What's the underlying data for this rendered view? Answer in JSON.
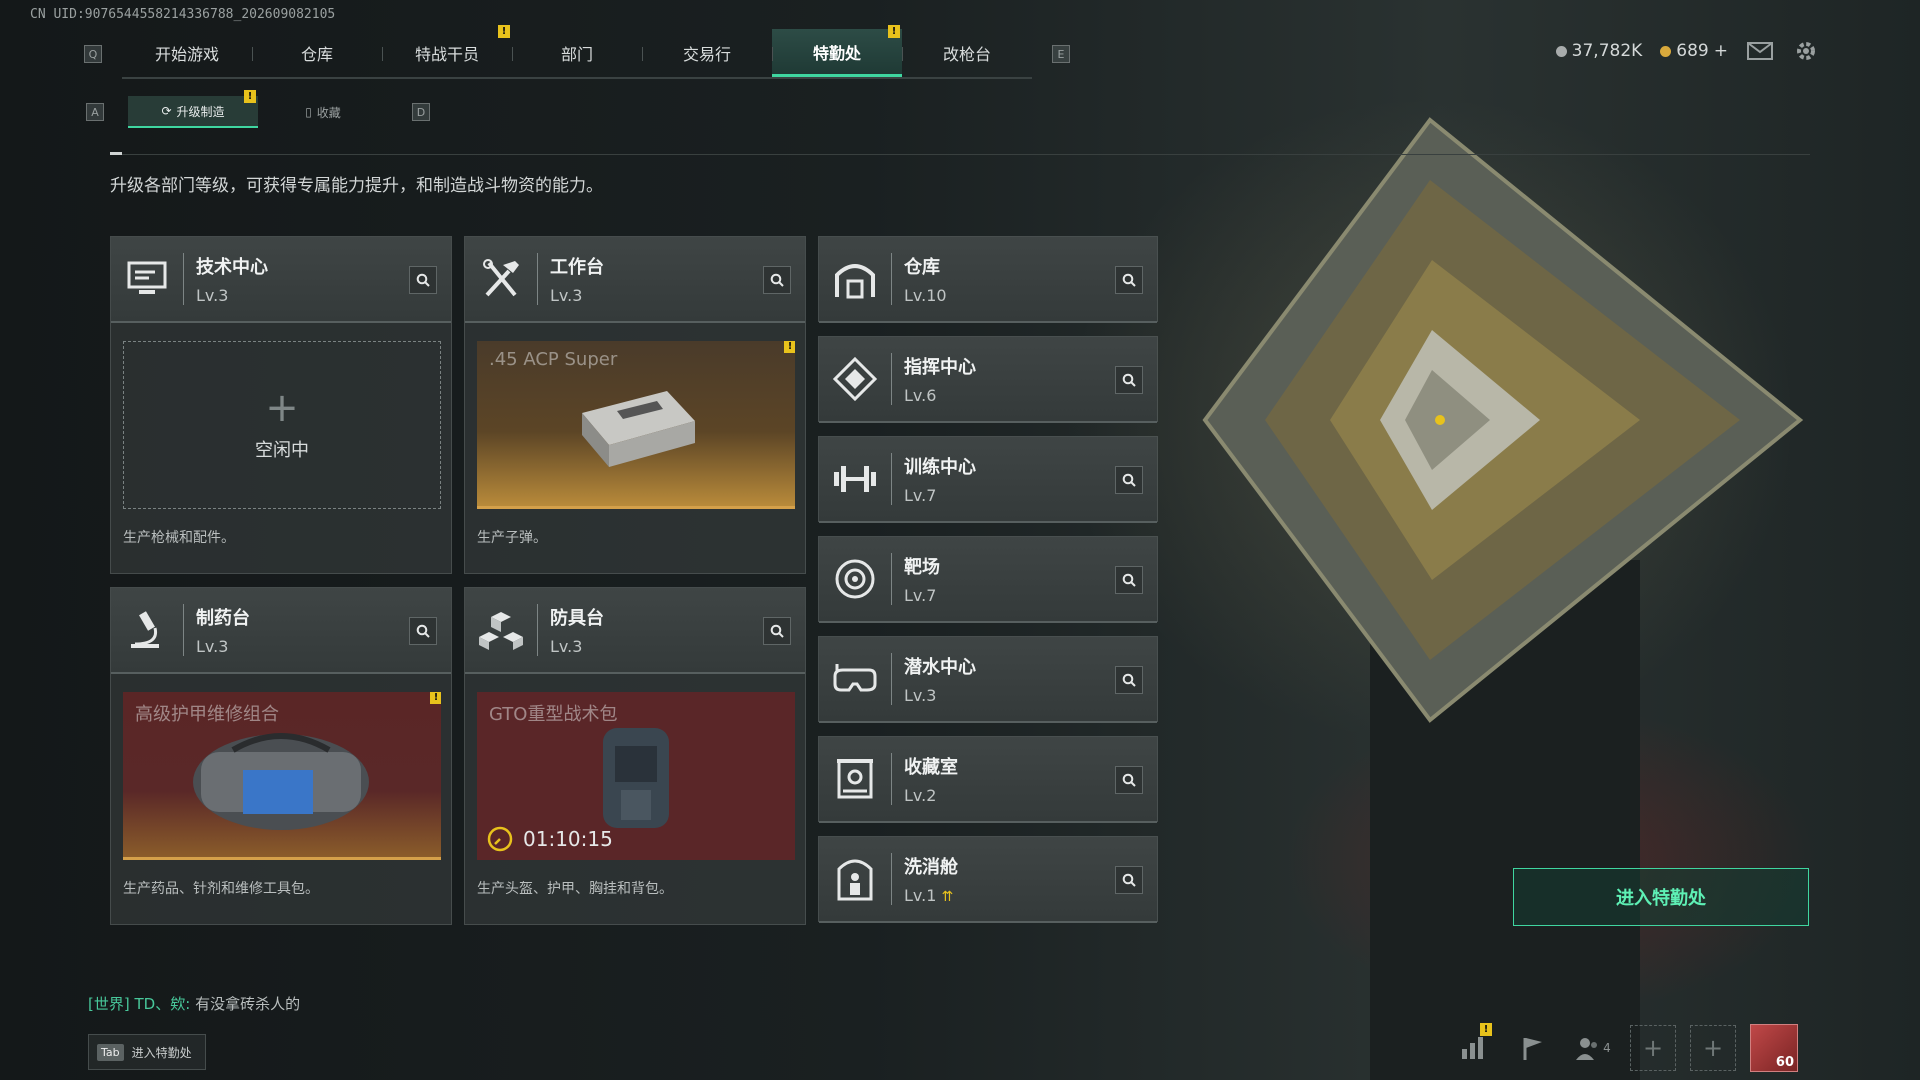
{
  "uid": "CN UID:9076544558214336788_202609082105",
  "nav": {
    "left_key": "Q",
    "right_key": "E",
    "tabs": [
      {
        "label": "开始游戏",
        "active": false,
        "badge": ""
      },
      {
        "label": "仓库",
        "active": false,
        "badge": ""
      },
      {
        "label": "特战干员",
        "active": false,
        "badge": "!"
      },
      {
        "label": "部门",
        "active": false,
        "badge": ""
      },
      {
        "label": "交易行",
        "active": false,
        "badge": ""
      },
      {
        "label": "特勤处",
        "active": true,
        "badge": "!"
      },
      {
        "label": "改枪台",
        "active": false,
        "badge": ""
      }
    ]
  },
  "currency": {
    "silver": "37,782K",
    "gold": "689",
    "gold_add": "+",
    "silver_color": "#a8acac",
    "gold_color": "#d8a93c"
  },
  "subnav": {
    "left_key": "A",
    "right_key": "D",
    "tabs": [
      {
        "label": "升级制造",
        "badge": "!"
      },
      {
        "label": "收藏"
      }
    ]
  },
  "description": "升级各部门等级，可获得专属能力提升，和制造战斗物资的能力。",
  "production": [
    {
      "name": "技术中心",
      "level": "Lv.3",
      "icon": "monitor-icon",
      "slot_status": "空闲中",
      "footer": "生产枪械和配件。"
    },
    {
      "name": "工作台",
      "level": "Lv.3",
      "icon": "tools-icon",
      "item_name": ".45 ACP Super",
      "badge": "!",
      "footer": "生产子弹。"
    },
    {
      "name": "制药台",
      "level": "Lv.3",
      "icon": "microscope-icon",
      "item_name": "高级护甲维修组合",
      "badge": "!",
      "footer": "生产药品、针剂和维修工具包。"
    },
    {
      "name": "防具台",
      "level": "Lv.3",
      "icon": "cubes-icon",
      "item_name": "GTO重型战术包",
      "timer": "01:10:15",
      "footer": "生产头盔、护甲、胸挂和背包。"
    }
  ],
  "facilities": [
    {
      "name": "仓库",
      "level": "Lv.10",
      "icon": "warehouse-icon"
    },
    {
      "name": "指挥中心",
      "level": "Lv.6",
      "icon": "command-icon"
    },
    {
      "name": "训练中心",
      "level": "Lv.7",
      "icon": "dumbbell-icon"
    },
    {
      "name": "靶场",
      "level": "Lv.7",
      "icon": "target-icon"
    },
    {
      "name": "潜水中心",
      "level": "Lv.3",
      "icon": "diving-mask-icon"
    },
    {
      "name": "收藏室",
      "level": "Lv.2",
      "icon": "collection-icon"
    },
    {
      "name": "洗消舱",
      "level": "Lv.1",
      "icon": "decon-icon",
      "upgradable": true
    }
  ],
  "enter_button": "进入特勤处",
  "chat": {
    "channel": "[世界]",
    "sender": "TD、欸:",
    "message": "有没拿砖杀人的"
  },
  "tab_hint": {
    "key": "Tab",
    "label": "进入特勤处"
  },
  "bottom": {
    "party_count": "4",
    "player_level": "60",
    "badge": "!"
  }
}
